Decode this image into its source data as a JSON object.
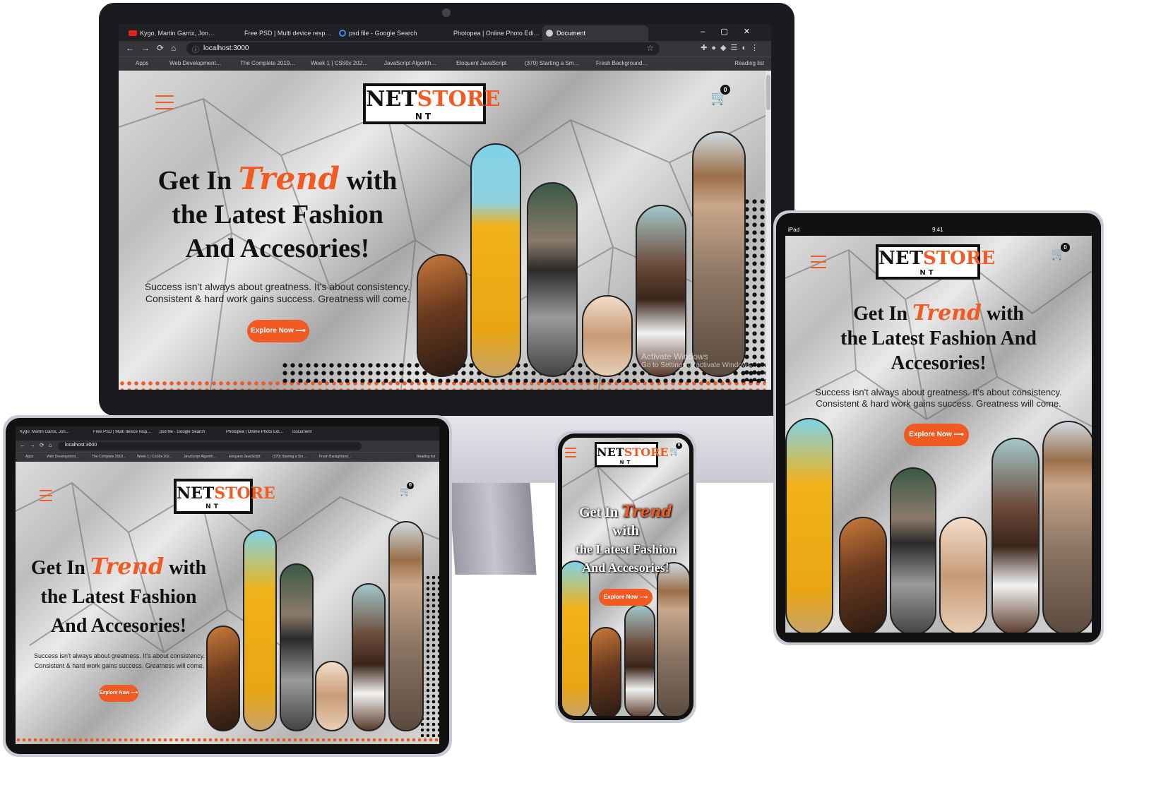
{
  "desktop": {
    "tabs": [
      {
        "label": "Kygo, Martin Garrix, Jon…"
      },
      {
        "label": "Free PSD | Multi device resp…"
      },
      {
        "label": "psd file - Google Search"
      },
      {
        "label": "Photopea | Online Photo Edi…"
      },
      {
        "label": "Document"
      }
    ],
    "address": "localhost:3000",
    "bookmarks": [
      {
        "label": "Apps"
      },
      {
        "label": "Web Development…"
      },
      {
        "label": "The Complete 2019…"
      },
      {
        "label": "Week 1 | CS50x 202…"
      },
      {
        "label": "JavaScript Algorith…"
      },
      {
        "label": "Eloquent JavaScript"
      },
      {
        "label": "(370) Starting a Sm…"
      },
      {
        "label": "Fresh Background…"
      }
    ],
    "reading_list": "Reading list",
    "watermark_1": "Activate Windows",
    "watermark_2": "Go to Settings to activate Windows."
  },
  "laptop": {
    "tabs": [
      {
        "label": "Kygo, Martin Garrix, Jon…"
      },
      {
        "label": "Free PSD | Multi device resp…"
      },
      {
        "label": "psd file - Google Search"
      },
      {
        "label": "Photopea | Online Photo Edi…"
      },
      {
        "label": "Document"
      }
    ],
    "address": "localhost:3000",
    "bookmarks": [
      {
        "label": "Apps"
      },
      {
        "label": "Web Development…"
      },
      {
        "label": "The Complete 2019…"
      },
      {
        "label": "Week 1 | CS50x 202…"
      },
      {
        "label": "JavaScript Algorith…"
      },
      {
        "label": "Eloquent JavaScript"
      },
      {
        "label": "(370) Starting a Sm…"
      },
      {
        "label": "Fresh Background…"
      }
    ],
    "reading_list": "Reading list"
  },
  "tablet": {
    "status_left": "iPad",
    "status_time": "9:41"
  },
  "site": {
    "logo_net": "NET",
    "logo_store": "STORE",
    "logo_nt": "NT",
    "cart_count": "0",
    "headline_pre": "Get In ",
    "headline_trend": "Trend",
    "headline_with": " with",
    "headline_line2": "the Latest Fashion",
    "headline_line2_tablet": "the Latest Fashion And",
    "headline_line3": "And Accesories!",
    "headline_line3_tablet": "Accesories!",
    "subtext_1": "Success isn't always about greatness. It's about consistency.",
    "subtext_2": "Consistent & hard work gains success. Greatness will come.",
    "cta": "Explore Now ⟶"
  },
  "colors": {
    "accent": "#f15a22",
    "dark": "#111111"
  },
  "icons": [
    "hamburger-menu-icon",
    "cart-icon",
    "youtube-icon",
    "google-icon",
    "chrome-icon",
    "reload-icon",
    "home-icon",
    "star-icon"
  ]
}
